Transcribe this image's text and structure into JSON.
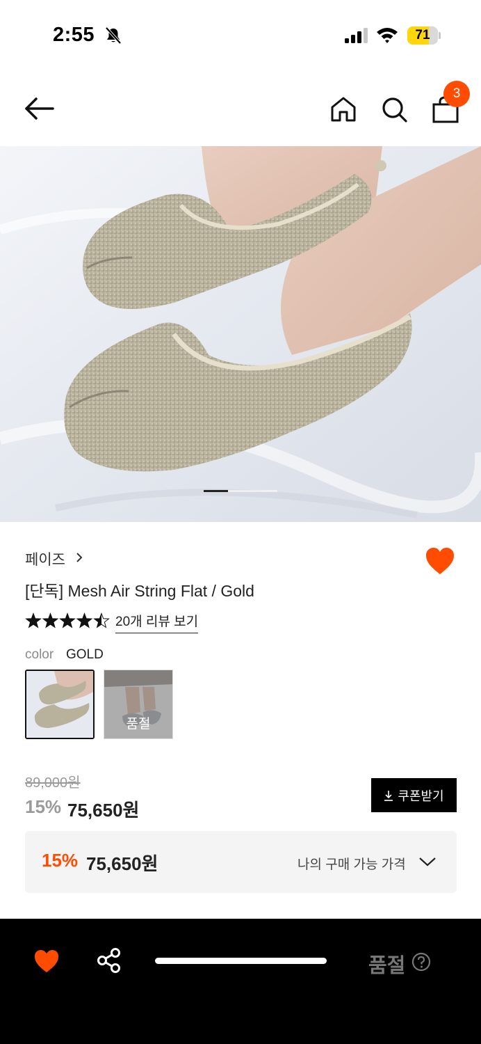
{
  "status_bar": {
    "time": "2:55",
    "battery": "71",
    "battery_level": 0.71
  },
  "nav": {
    "cart_count": "3"
  },
  "product": {
    "brand": "페이즈",
    "title": "[단독] Mesh Air String Flat / Gold",
    "rating": 4.5,
    "review_link": "20개 리뷰 보기",
    "color_label": "color",
    "color_value": "GOLD",
    "soldout_swatch_label": "품절",
    "carousel": {
      "total": 3,
      "active": 1
    }
  },
  "price": {
    "original": "89,000원",
    "discount_rate": "15%",
    "sale": "75,650원",
    "coupon_button": "쿠폰받기"
  },
  "my_price": {
    "rate": "15%",
    "value": "75,650원",
    "label": "나의 구매 가능 가격"
  },
  "bottom_bar": {
    "soldout": "품절"
  },
  "colors": {
    "accent": "#ff4c00",
    "dark": "#000000"
  }
}
